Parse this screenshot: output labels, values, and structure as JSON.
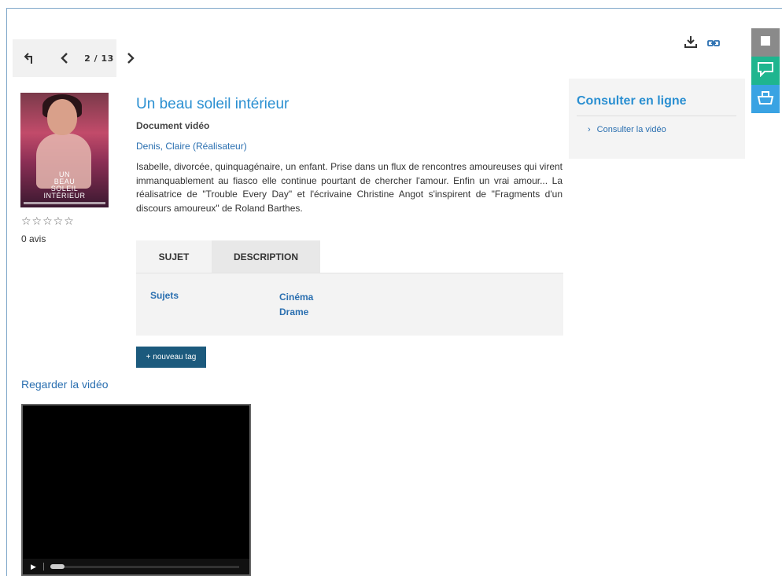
{
  "nav": {
    "back_label": "Retour",
    "counter": "2 / 13"
  },
  "tools": {
    "download_icon": "download-icon",
    "link_icon": "link-icon"
  },
  "side_icons": [
    "stop-icon",
    "comment-icon",
    "basket-icon"
  ],
  "record": {
    "title": "Un beau soleil intérieur",
    "doc_type": "Document vidéo",
    "author": "Denis, Claire (Réalisateur)",
    "summary": "Isabelle, divorcée, quinquagénaire, un enfant. Prise dans un flux de rencontres amoureuses qui virent immanquablement au fiasco elle continue pourtant de chercher l'amour. Enfin un vrai amour... La réalisatrice de \"Trouble Every Day\" et l'écrivaine Christine Angot s'inspirent de \"Fragments d'un discours amoureux\" de Roland Barthes.",
    "stars": "☆☆☆☆☆",
    "reviews": "0 avis",
    "poster_title": [
      "UN",
      "BEAU",
      "SOLEIL",
      "INTÉRIEUR"
    ]
  },
  "tabs": {
    "items": [
      "SUJET",
      "DESCRIPTION"
    ],
    "subject_label": "Sujets",
    "subjects": [
      "Cinéma",
      "Drame"
    ]
  },
  "new_tag_label": "+ nouveau tag",
  "video": {
    "heading": "Regarder la vidéo",
    "play_symbol": "▶"
  },
  "consult": {
    "heading": "Consulter en ligne",
    "link": "Consulter la vidéo"
  },
  "colors": {
    "accent": "#2a8fd1",
    "link": "#2a6fb0",
    "side_gray": "#8a8a8a",
    "side_green": "#1fb58f",
    "side_blue": "#3aa3e3",
    "tag_button": "#1c5a7d"
  }
}
